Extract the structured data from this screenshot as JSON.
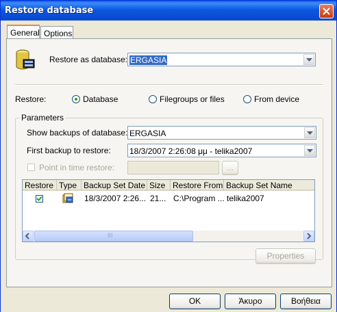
{
  "window": {
    "title": "Restore database"
  },
  "tabs": [
    {
      "label": "General"
    },
    {
      "label": "Options"
    }
  ],
  "restore_as": {
    "label": "Restore as database:",
    "value": "ERGASIA"
  },
  "restore_mode": {
    "label": "Restore:",
    "options": [
      {
        "label": "Database",
        "checked": true
      },
      {
        "label": "Filegroups or files",
        "checked": false
      },
      {
        "label": "From device",
        "checked": false
      }
    ]
  },
  "parameters": {
    "title": "Parameters",
    "show_backups_label": "Show backups of database:",
    "show_backups_value": "ERGASIA",
    "first_backup_label": "First backup to restore:",
    "first_backup_value": "18/3/2007 2:26:08 μμ - telika2007",
    "point_in_time_label": "Point in time restore:",
    "point_in_time_value": "",
    "browse_label": "..."
  },
  "backup_grid": {
    "columns": [
      "Restore",
      "Type",
      "Backup Set Date",
      "Size",
      "Restore From",
      "Backup Set Name"
    ],
    "rows": [
      {
        "restore": true,
        "type_icon": "database-backup-icon",
        "date": "18/3/2007 2:26...",
        "size": "21...",
        "from": "C:\\Program ...",
        "name": "telika2007"
      }
    ],
    "scroll_grip": "III"
  },
  "properties_button": "Properties",
  "footer": {
    "ok": "OK",
    "cancel": "Άκυρο",
    "help": "Βοήθεια"
  },
  "colors": {
    "title_bar": "#0a5ee8",
    "dialog_bg": "#ece9d8",
    "tab_highlight": "#e68b2c"
  }
}
